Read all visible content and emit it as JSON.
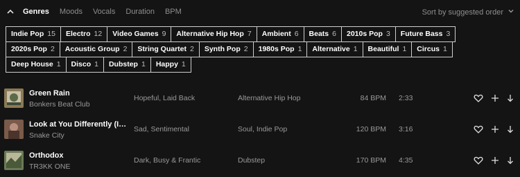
{
  "filter_tabs": [
    {
      "label": "Genres",
      "active": true
    },
    {
      "label": "Moods",
      "active": false
    },
    {
      "label": "Vocals",
      "active": false
    },
    {
      "label": "Duration",
      "active": false
    },
    {
      "label": "BPM",
      "active": false
    }
  ],
  "sort_label": "Sort by suggested order",
  "genres": [
    {
      "name": "Indie Pop",
      "count": "15"
    },
    {
      "name": "Electro",
      "count": "12"
    },
    {
      "name": "Video Games",
      "count": "9"
    },
    {
      "name": "Alternative Hip Hop",
      "count": "7"
    },
    {
      "name": "Ambient",
      "count": "6"
    },
    {
      "name": "Beats",
      "count": "6"
    },
    {
      "name": "2010s Pop",
      "count": "3"
    },
    {
      "name": "Future Bass",
      "count": "3"
    },
    {
      "name": "2020s Pop",
      "count": "2"
    },
    {
      "name": "Acoustic Group",
      "count": "2"
    },
    {
      "name": "String Quartet",
      "count": "2"
    },
    {
      "name": "Synth Pop",
      "count": "2"
    },
    {
      "name": "1980s Pop",
      "count": "1"
    },
    {
      "name": "Alternative",
      "count": "1"
    },
    {
      "name": "Beautiful",
      "count": "1"
    },
    {
      "name": "Circus",
      "count": "1"
    },
    {
      "name": "Deep House",
      "count": "1"
    },
    {
      "name": "Disco",
      "count": "1"
    },
    {
      "name": "Dubstep",
      "count": "1"
    },
    {
      "name": "Happy",
      "count": "1"
    }
  ],
  "tracks": [
    {
      "title": "Green Rain",
      "artist": "Bonkers Beat Club",
      "moods": "Hopeful, Laid Back",
      "genres": "Alternative Hip Hop",
      "bpm": "84 BPM",
      "duration": "2:33",
      "thumb_color": "#8a7a55"
    },
    {
      "title": "Look at You Differently (Instrumental)",
      "artist": "Snake City",
      "moods": "Sad, Sentimental",
      "genres": "Soul, Indie Pop",
      "bpm": "120 BPM",
      "duration": "3:16",
      "thumb_color": "#7a5a4a"
    },
    {
      "title": "Orthodox",
      "artist": "TR3KK ONE",
      "moods": "Dark, Busy & Frantic",
      "genres": "Dubstep",
      "bpm": "170 BPM",
      "duration": "4:35",
      "thumb_color": "#6a7a58"
    }
  ],
  "icons": {
    "collapse": "chevron-up-icon",
    "sort": "chevron-down-icon",
    "like": "heart-icon",
    "add": "plus-icon",
    "download": "arrow-down-icon"
  }
}
